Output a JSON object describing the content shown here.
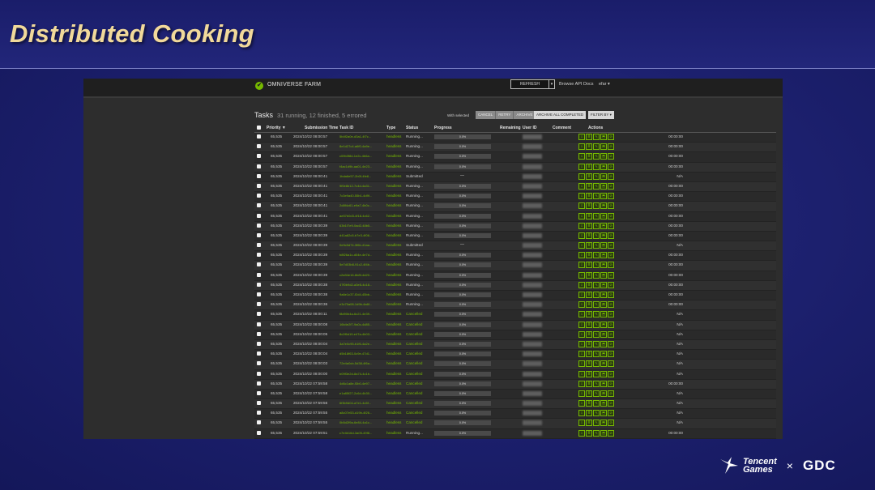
{
  "slide": {
    "title": "Distributed Cooking"
  },
  "app": {
    "logo": "✔",
    "name": "OMNIVERSE FARM",
    "refresh_label": "REFRESH",
    "refresh_caret": "▾",
    "browse_api": "Browse API Docs",
    "user_menu": "efar ▾"
  },
  "tasks": {
    "title": "Tasks",
    "summary": "31 running, 12 finished, 5 errored",
    "with_selected": "With selected",
    "bulk_actions": [
      "CANCEL",
      "RETRY",
      "ARCHIVE"
    ],
    "archive_all_label": "ARCHIVE ALL COMPLETED",
    "filter_label": "FILTER BY ▾"
  },
  "columns": {
    "priority": "Priority ▼",
    "submission_time": "Submission Time",
    "task_id": "Task ID",
    "type": "Type",
    "status": "Status",
    "progress": "Progress",
    "remaining": "Remaining",
    "user_id": "User ID",
    "comment": "Comment",
    "actions": "Actions"
  },
  "rows": [
    {
      "priority": "65,535",
      "time": "2024/10/22 08:00:57",
      "id": "5b4f2a0e-d3a1-4f7c...",
      "type": "headless",
      "status": "Running...",
      "progress": "0.0%",
      "remaining": "00:00:00"
    },
    {
      "priority": "65,535",
      "time": "2024/10/22 08:00:57",
      "id": "8e1d27c4-a6f0-4a9e...",
      "type": "headless",
      "status": "Running...",
      "progress": "0.0%",
      "remaining": "00:00:00"
    },
    {
      "priority": "65,535",
      "time": "2024/10/22 08:00:57",
      "id": "c09b3f8d-1e2c-4b6a...",
      "type": "headless",
      "status": "Running...",
      "progress": "0.0%",
      "remaining": "00:00:00"
    },
    {
      "priority": "65,535",
      "time": "2024/10/22 08:00:57",
      "id": "f4ac1d9b-aa01-4e23...",
      "type": "headless",
      "status": "Running...",
      "progress": "0.0%",
      "remaining": "00:00:00"
    },
    {
      "priority": "65,535",
      "time": "2024/10/22 08:00:41",
      "id": "1bda6e57-2b0f-4fe8...",
      "type": "headless",
      "status": "Submitted",
      "progress": "",
      "remaining": "N/A"
    },
    {
      "priority": "65,535",
      "time": "2024/10/22 08:00:41",
      "id": "9f0e8b12-7c4d-4a31...",
      "type": "headless",
      "status": "Running...",
      "progress": "0.0%",
      "remaining": "00:00:00"
    },
    {
      "priority": "65,535",
      "time": "2024/10/22 08:00:41",
      "id": "7c3e9a40-55b1-4d9f...",
      "type": "headless",
      "status": "Running...",
      "progress": "0.0%",
      "remaining": "00:00:00"
    },
    {
      "priority": "65,535",
      "time": "2024/10/22 08:00:41",
      "id": "2d8f4c61-e9a7-4b0c...",
      "type": "headless",
      "status": "Running...",
      "progress": "0.0%",
      "remaining": "00:00:00"
    },
    {
      "priority": "65,535",
      "time": "2024/10/22 08:00:41",
      "id": "ae57b0d3-4f18-4c62...",
      "type": "headless",
      "status": "Running...",
      "progress": "0.0%",
      "remaining": "00:00:00"
    },
    {
      "priority": "65,535",
      "time": "2024/10/22 08:00:39",
      "id": "63b1f7e9-0ad2-48b5...",
      "type": "headless",
      "status": "Running...",
      "progress": "0.0%",
      "remaining": "00:00:00"
    },
    {
      "priority": "65,535",
      "time": "2024/10/22 08:00:39",
      "id": "d41a82c5-b7e3-4f06...",
      "type": "headless",
      "status": "Running...",
      "progress": "0.0%",
      "remaining": "00:00:00"
    },
    {
      "priority": "65,535",
      "time": "2024/10/22 08:00:39",
      "id": "0e9c5d74-3f6b-41aa...",
      "type": "headless",
      "status": "Submitted",
      "progress": "",
      "remaining": "N/A"
    },
    {
      "priority": "65,535",
      "time": "2024/10/22 08:00:39",
      "id": "b8f26a1c-d04e-4e7d...",
      "type": "headless",
      "status": "Running...",
      "progress": "0.0%",
      "remaining": "00:00:00"
    },
    {
      "priority": "65,535",
      "time": "2024/10/22 08:00:39",
      "id": "5e7d03b8-91c2-4f4b...",
      "type": "headless",
      "status": "Running...",
      "progress": "0.0%",
      "remaining": "00:00:00"
    },
    {
      "priority": "65,535",
      "time": "2024/10/22 08:00:39",
      "id": "c2a94e16-6b8f-4d20...",
      "type": "headless",
      "status": "Running...",
      "progress": "0.0%",
      "remaining": "00:00:00"
    },
    {
      "priority": "65,535",
      "time": "2024/10/22 08:00:38",
      "id": "47f0b9d2-a3e5-4c18...",
      "type": "headless",
      "status": "Running...",
      "progress": "0.0%",
      "remaining": "00:00:00"
    },
    {
      "priority": "65,535",
      "time": "2024/10/22 08:00:38",
      "id": "9a6e1c37-f2d4-45bb...",
      "type": "headless",
      "status": "Running...",
      "progress": "0.0%",
      "remaining": "00:00:00"
    },
    {
      "priority": "65,535",
      "time": "2024/10/22 08:00:36",
      "id": "e3c75a08-1d9b-4a6f...",
      "type": "headless",
      "status": "Running...",
      "progress": "0.0%",
      "remaining": "00:00:00"
    },
    {
      "priority": "65,535",
      "time": "2024/10/22 08:00:11",
      "id": "f8d90b4a-6c21-4e39...",
      "type": "headless",
      "status": "Cancelled",
      "progress": "0.0%",
      "remaining": "N/A"
    },
    {
      "priority": "65,535",
      "time": "2024/10/22 08:00:08",
      "id": "16b4e2f7-9a0c-4d85...",
      "type": "headless",
      "status": "Cancelled",
      "progress": "0.0%",
      "remaining": "N/A"
    },
    {
      "priority": "65,535",
      "time": "2024/10/22 08:00:05",
      "id": "8c2f6d19-e47a-4b03...",
      "type": "headless",
      "status": "Cancelled",
      "progress": "0.0%",
      "remaining": "N/A"
    },
    {
      "priority": "65,535",
      "time": "2024/10/22 08:00:04",
      "id": "3a7e0c95-b1f6-4a2e...",
      "type": "headless",
      "status": "Cancelled",
      "progress": "0.0%",
      "remaining": "N/A"
    },
    {
      "priority": "65,535",
      "time": "2024/10/22 08:00:04",
      "id": "d5b18f63-0c9e-47d1...",
      "type": "headless",
      "status": "Cancelled",
      "progress": "0.0%",
      "remaining": "N/A"
    },
    {
      "priority": "65,535",
      "time": "2024/10/22 08:00:03",
      "id": "72e4a0cb-5d38-4f6a...",
      "type": "headless",
      "status": "Cancelled",
      "progress": "0.0%",
      "remaining": "N/A"
    },
    {
      "priority": "65,535",
      "time": "2024/10/22 08:00:00",
      "id": "b09f3e2d-8a74-4c1b...",
      "type": "headless",
      "status": "Cancelled",
      "progress": "0.0%",
      "remaining": "N/A"
    },
    {
      "priority": "65,535",
      "time": "2024/10/22 07:59:58",
      "id": "4d6c1a8e-f3b0-4e97...",
      "type": "headless",
      "status": "Cancelled",
      "progress": "0.0%",
      "remaining": "00:00:00"
    },
    {
      "priority": "65,535",
      "time": "2024/10/22 07:59:58",
      "id": "e1a85f27-2c6d-4b30...",
      "type": "headless",
      "status": "Cancelled",
      "progress": "0.0%",
      "remaining": "N/A"
    },
    {
      "priority": "65,535",
      "time": "2024/10/22 07:59:56",
      "id": "6f3b9d04-a7e1-4c5f...",
      "type": "headless",
      "status": "Cancelled",
      "progress": "0.0%",
      "remaining": "N/A"
    },
    {
      "priority": "65,535",
      "time": "2024/10/22 07:59:55",
      "id": "a8c07e53-d19b-4f26...",
      "type": "headless",
      "status": "Cancelled",
      "progress": "0.0%",
      "remaining": "N/A"
    },
    {
      "priority": "65,535",
      "time": "2024/10/22 07:59:55",
      "id": "0b5d2f9a-6e84-4a1c...",
      "type": "headless",
      "status": "Cancelled",
      "progress": "0.0%",
      "remaining": "N/A"
    },
    {
      "priority": "65,535",
      "time": "2024/10/22 07:59:51",
      "id": "c7e4b16d-3a05-49f8...",
      "type": "headless",
      "status": "Running...",
      "progress": "0.0%",
      "remaining": "00:00:00"
    },
    {
      "priority": "65,535",
      "time": "2024/10/22 07:59:50",
      "id": "59a2d83f-b0c7-4e14...",
      "type": "headless",
      "status": "Running...",
      "progress": "0.0%",
      "remaining": "00:00:00"
    },
    {
      "priority": "65,535",
      "time": "2024/10/22 07:59:46",
      "id": "f20e7c48-1b96-4d3a...",
      "type": "headless",
      "status": "Running...",
      "progress": "0.0%",
      "remaining": "00:00:00"
    },
    {
      "priority": "65,535",
      "time": "2024/10/22 07:58:58",
      "id": "8d61a0f5-c4e2-4b79...",
      "type": "headless",
      "status": "Cancelled",
      "progress": "0.0%",
      "remaining": "N/A"
    }
  ],
  "action_icons": [
    "⇩",
    "≣",
    "✎",
    "⬒",
    "⊘"
  ],
  "colors": {
    "accent": "#76b900",
    "slide_title": "#f1d99a",
    "slide_bg": "#1d2170"
  },
  "branding": {
    "tencent_line1": "Tencent",
    "tencent_line2": "Games",
    "cross": "×",
    "gdc": "GDC"
  }
}
